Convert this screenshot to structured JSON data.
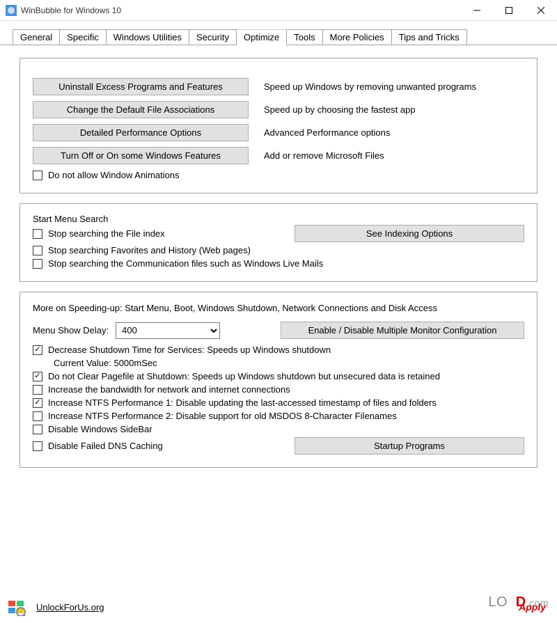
{
  "window": {
    "title": "WinBubble for Windows 10"
  },
  "tabs": [
    "General",
    "Specific",
    "Windows Utilities",
    "Security",
    "Optimize",
    "Tools",
    "More Policies",
    "Tips and Tricks"
  ],
  "active_tab": "Optimize",
  "topbox": {
    "rows": [
      {
        "btn": "Uninstall Excess Programs and Features",
        "desc": "Speed up Windows by removing unwanted programs"
      },
      {
        "btn": "Change the Default File Associations",
        "desc": "Speed up by choosing the fastest app"
      },
      {
        "btn": "Detailed Performance Options",
        "desc": "Advanced Performance options"
      },
      {
        "btn": "Turn Off or On  some Windows Features",
        "desc": "Add or remove Microsoft Files"
      }
    ],
    "chk_no_anim": "Do not allow Window Animations"
  },
  "search": {
    "title": "Start Menu Search",
    "btn_index": "See Indexing Options",
    "chk1": "Stop searching the File index",
    "chk2": "Stop searching Favorites and History (Web pages)",
    "chk3": "Stop searching the Communication files such as Windows Live Mails"
  },
  "speed": {
    "title": "More on Speeding-up: Start Menu, Boot, Windows Shutdown, Network Connections and Disk Access",
    "menu_delay_label": "Menu Show Delay:",
    "menu_delay_value": "400",
    "btn_monitor": "Enable / Disable Multiple Monitor Configuration",
    "chk_shutdown": "Decrease Shutdown Time for Services: Speeds up Windows shutdown",
    "chk_shutdown_val": "Current Value: 5000mSec",
    "chk_pagefile": "Do not Clear Pagefile at Shutdown: Speeds up Windows shutdown but unsecured data is retained",
    "chk_bandwidth": "Increase the bandwidth for network and internet connections",
    "chk_ntfs1": "Increase NTFS Performance 1: Disable updating the last-accessed timestamp of files and folders",
    "chk_ntfs2": "Increase NTFS Performance 2: Disable support for old MSDOS 8-Character Filenames",
    "chk_sidebar": "Disable Windows SideBar",
    "chk_dns": "Disable Failed DNS Caching",
    "btn_startup": "Startup Programs"
  },
  "footer": {
    "link": "UnlockForUs.org",
    "apply": "Apply"
  },
  "watermark": {
    "lo": "LO",
    "num": "4",
    "d": "D",
    "com": ".com"
  }
}
